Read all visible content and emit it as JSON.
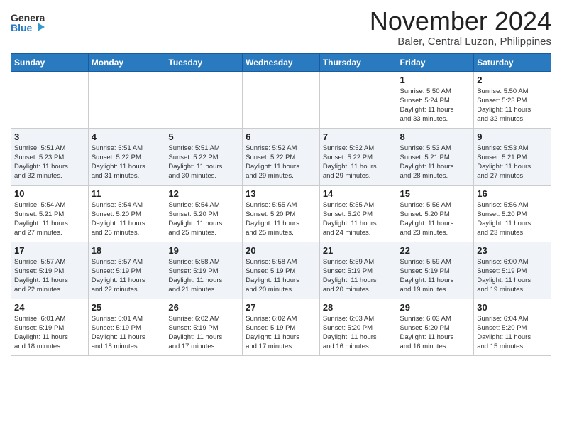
{
  "logo": {
    "line1": "General",
    "line2": "Blue"
  },
  "header": {
    "month_year": "November 2024",
    "location": "Baler, Central Luzon, Philippines"
  },
  "weekdays": [
    "Sunday",
    "Monday",
    "Tuesday",
    "Wednesday",
    "Thursday",
    "Friday",
    "Saturday"
  ],
  "weeks": [
    [
      {
        "day": "",
        "info": ""
      },
      {
        "day": "",
        "info": ""
      },
      {
        "day": "",
        "info": ""
      },
      {
        "day": "",
        "info": ""
      },
      {
        "day": "",
        "info": ""
      },
      {
        "day": "1",
        "info": "Sunrise: 5:50 AM\nSunset: 5:24 PM\nDaylight: 11 hours\nand 33 minutes."
      },
      {
        "day": "2",
        "info": "Sunrise: 5:50 AM\nSunset: 5:23 PM\nDaylight: 11 hours\nand 32 minutes."
      }
    ],
    [
      {
        "day": "3",
        "info": "Sunrise: 5:51 AM\nSunset: 5:23 PM\nDaylight: 11 hours\nand 32 minutes."
      },
      {
        "day": "4",
        "info": "Sunrise: 5:51 AM\nSunset: 5:22 PM\nDaylight: 11 hours\nand 31 minutes."
      },
      {
        "day": "5",
        "info": "Sunrise: 5:51 AM\nSunset: 5:22 PM\nDaylight: 11 hours\nand 30 minutes."
      },
      {
        "day": "6",
        "info": "Sunrise: 5:52 AM\nSunset: 5:22 PM\nDaylight: 11 hours\nand 29 minutes."
      },
      {
        "day": "7",
        "info": "Sunrise: 5:52 AM\nSunset: 5:22 PM\nDaylight: 11 hours\nand 29 minutes."
      },
      {
        "day": "8",
        "info": "Sunrise: 5:53 AM\nSunset: 5:21 PM\nDaylight: 11 hours\nand 28 minutes."
      },
      {
        "day": "9",
        "info": "Sunrise: 5:53 AM\nSunset: 5:21 PM\nDaylight: 11 hours\nand 27 minutes."
      }
    ],
    [
      {
        "day": "10",
        "info": "Sunrise: 5:54 AM\nSunset: 5:21 PM\nDaylight: 11 hours\nand 27 minutes."
      },
      {
        "day": "11",
        "info": "Sunrise: 5:54 AM\nSunset: 5:20 PM\nDaylight: 11 hours\nand 26 minutes."
      },
      {
        "day": "12",
        "info": "Sunrise: 5:54 AM\nSunset: 5:20 PM\nDaylight: 11 hours\nand 25 minutes."
      },
      {
        "day": "13",
        "info": "Sunrise: 5:55 AM\nSunset: 5:20 PM\nDaylight: 11 hours\nand 25 minutes."
      },
      {
        "day": "14",
        "info": "Sunrise: 5:55 AM\nSunset: 5:20 PM\nDaylight: 11 hours\nand 24 minutes."
      },
      {
        "day": "15",
        "info": "Sunrise: 5:56 AM\nSunset: 5:20 PM\nDaylight: 11 hours\nand 23 minutes."
      },
      {
        "day": "16",
        "info": "Sunrise: 5:56 AM\nSunset: 5:20 PM\nDaylight: 11 hours\nand 23 minutes."
      }
    ],
    [
      {
        "day": "17",
        "info": "Sunrise: 5:57 AM\nSunset: 5:19 PM\nDaylight: 11 hours\nand 22 minutes."
      },
      {
        "day": "18",
        "info": "Sunrise: 5:57 AM\nSunset: 5:19 PM\nDaylight: 11 hours\nand 22 minutes."
      },
      {
        "day": "19",
        "info": "Sunrise: 5:58 AM\nSunset: 5:19 PM\nDaylight: 11 hours\nand 21 minutes."
      },
      {
        "day": "20",
        "info": "Sunrise: 5:58 AM\nSunset: 5:19 PM\nDaylight: 11 hours\nand 20 minutes."
      },
      {
        "day": "21",
        "info": "Sunrise: 5:59 AM\nSunset: 5:19 PM\nDaylight: 11 hours\nand 20 minutes."
      },
      {
        "day": "22",
        "info": "Sunrise: 5:59 AM\nSunset: 5:19 PM\nDaylight: 11 hours\nand 19 minutes."
      },
      {
        "day": "23",
        "info": "Sunrise: 6:00 AM\nSunset: 5:19 PM\nDaylight: 11 hours\nand 19 minutes."
      }
    ],
    [
      {
        "day": "24",
        "info": "Sunrise: 6:01 AM\nSunset: 5:19 PM\nDaylight: 11 hours\nand 18 minutes."
      },
      {
        "day": "25",
        "info": "Sunrise: 6:01 AM\nSunset: 5:19 PM\nDaylight: 11 hours\nand 18 minutes."
      },
      {
        "day": "26",
        "info": "Sunrise: 6:02 AM\nSunset: 5:19 PM\nDaylight: 11 hours\nand 17 minutes."
      },
      {
        "day": "27",
        "info": "Sunrise: 6:02 AM\nSunset: 5:19 PM\nDaylight: 11 hours\nand 17 minutes."
      },
      {
        "day": "28",
        "info": "Sunrise: 6:03 AM\nSunset: 5:20 PM\nDaylight: 11 hours\nand 16 minutes."
      },
      {
        "day": "29",
        "info": "Sunrise: 6:03 AM\nSunset: 5:20 PM\nDaylight: 11 hours\nand 16 minutes."
      },
      {
        "day": "30",
        "info": "Sunrise: 6:04 AM\nSunset: 5:20 PM\nDaylight: 11 hours\nand 15 minutes."
      }
    ]
  ]
}
